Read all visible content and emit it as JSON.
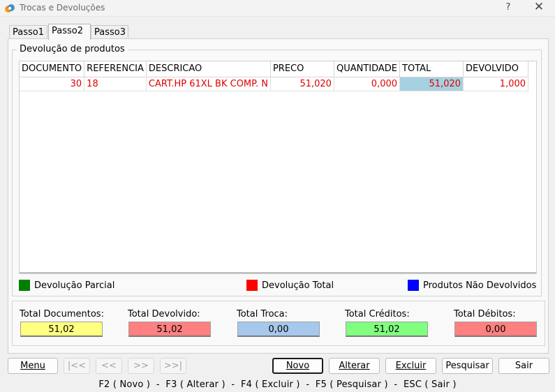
{
  "window": {
    "title": "Trocas e Devoluções",
    "help_glyph": "?",
    "close_glyph": "✕"
  },
  "tabs": [
    {
      "label": "Passo1",
      "active": false
    },
    {
      "label": "Passo2",
      "active": true
    },
    {
      "label": "Passo3",
      "active": false
    }
  ],
  "devolucao": {
    "legend": "Devolução de produtos",
    "columns": [
      "DOCUMENTO",
      "REFERENCIA",
      "DESCRICAO",
      "PRECO",
      "QUANTIDADE",
      "TOTAL",
      "DEVOLVIDO"
    ],
    "rows": [
      {
        "documento": "30",
        "referencia": "18",
        "descricao": "CART.HP 61XL BK COMP. N",
        "preco": "51,020",
        "quantidade": "0,000",
        "total": "51,020",
        "devolvido": "1,000"
      }
    ]
  },
  "legend": [
    {
      "label": "Devolução Parcial",
      "color": "#008000"
    },
    {
      "label": "Devolução Total",
      "color": "#ff0000"
    },
    {
      "label": "Produtos Não Devolvidos",
      "color": "#0000ff"
    }
  ],
  "totals": [
    {
      "label": "Total Documentos:",
      "value": "51,02",
      "color": "#ffff80"
    },
    {
      "label": "Total Devolvido:",
      "value": "51,02",
      "color": "#ff8080"
    },
    {
      "label": "Total Troca:",
      "value": "0,00",
      "color": "#a6c8ec"
    },
    {
      "label": "Total Créditos:",
      "value": "51,02",
      "color": "#80ff80"
    },
    {
      "label": "Total Débitos:",
      "value": "0,00",
      "color": "#ff8080"
    }
  ],
  "buttons": {
    "menu": "Menu",
    "first": "|<<",
    "prev": "<<",
    "next": ">>",
    "last": ">>|",
    "novo": "Novo",
    "alterar": "Alterar",
    "excluir": "Excluir",
    "pesquisar": "Pesquisar",
    "sair": "Sair"
  },
  "statusbar": "F2 ( Novo )  -  F3 ( Alterar )  -  F4 ( Excluir )  -  F5 ( Pesquisar )  -  ESC ( Sair )"
}
